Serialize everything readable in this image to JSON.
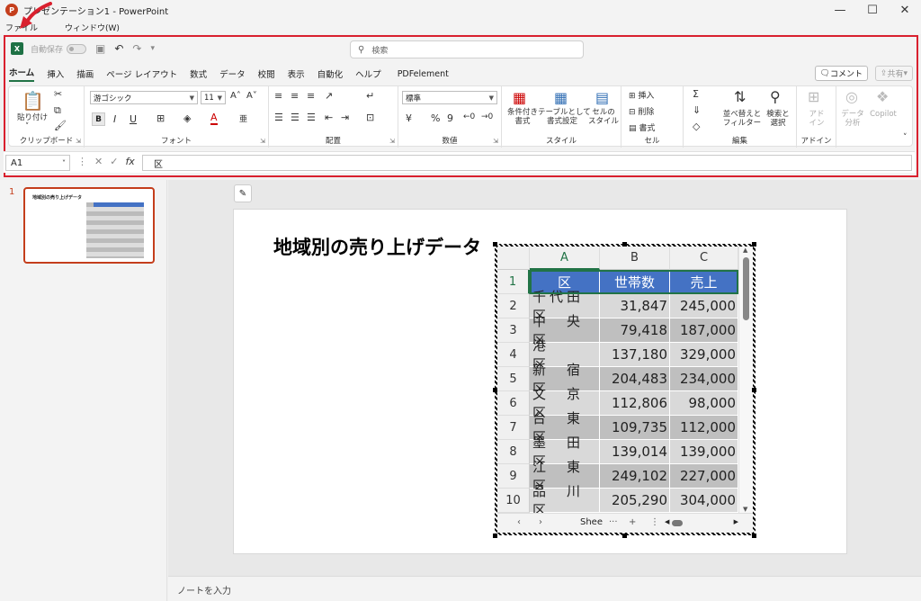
{
  "window": {
    "title": "プレゼンテーション1 - PowerPoint",
    "app_icon_letter": "P",
    "minimize": "—",
    "maximize": "☐",
    "close": "✕"
  },
  "menubar": {
    "file": "ファイル",
    "window": "ウィンドウ(W)"
  },
  "qat": {
    "excel_letter": "X",
    "autosave": "自動保存",
    "toggle_state": "オフ",
    "search_placeholder": "検索"
  },
  "tabs": [
    "ホーム",
    "挿入",
    "描画",
    "ページ レイアウト",
    "数式",
    "データ",
    "校閲",
    "表示",
    "自動化",
    "ヘルプ",
    "PDFelement"
  ],
  "comment_button": "コメント",
  "share_button": "共有",
  "ribbon": {
    "clipboard": {
      "paste": "貼り付け",
      "label": "クリップボード"
    },
    "font": {
      "font_name": "游ゴシック",
      "font_size": "11",
      "label": "フォント",
      "bold": "B",
      "italic": "I",
      "underline": "U",
      "grow": "A˄",
      "shrink": "A˅",
      "color_a": "A"
    },
    "alignment": {
      "label": "配置"
    },
    "number": {
      "format": "標準",
      "percent": "%",
      "comma": "9",
      "label": "数値"
    },
    "style": {
      "conditional": "条件付き\n書式",
      "as_table": "テーブルとして\n書式設定",
      "cell_style": "セルの\nスタイル",
      "label": "スタイル"
    },
    "cells": {
      "insert": "挿入",
      "delete": "削除",
      "format": "書式",
      "label": "セル"
    },
    "editing": {
      "sort_filter": "並べ替えと\nフィルター",
      "find_select": "検索と\n選択",
      "label": "編集"
    },
    "addins": {
      "addins": "アド\nイン",
      "label": "アドイン"
    },
    "data_analysis": "データ\n分析",
    "copilot": "Copilot"
  },
  "formula_bar": {
    "name_box": "A1",
    "fx": "fx",
    "content": "区"
  },
  "slide_pane": {
    "slide_number": "1",
    "thumb_title": "地域別の売り上げデータ"
  },
  "slide": {
    "title": "地域別の売り上げデータ"
  },
  "sheet": {
    "columns": [
      "A",
      "B",
      "C"
    ],
    "rows": [
      "1",
      "2",
      "3",
      "4",
      "5",
      "6",
      "7",
      "8",
      "9",
      "10"
    ],
    "header": [
      "区",
      "世帯数",
      "売上"
    ],
    "data": [
      [
        "千代田区",
        "31,847",
        "245,000"
      ],
      [
        "中　央　区",
        "79,418",
        "187,000"
      ],
      [
        "港　　　区",
        "137,180",
        "329,000"
      ],
      [
        "新　宿　区",
        "204,483",
        "234,000"
      ],
      [
        "文　京　区",
        "112,806",
        "98,000"
      ],
      [
        "台　東　区",
        "109,735",
        "112,000"
      ],
      [
        "墨　田　区",
        "139,014",
        "139,000"
      ],
      [
        "江　東　区",
        "249,102",
        "227,000"
      ],
      [
        "品　川　区",
        "205,290",
        "304,000"
      ]
    ],
    "sheet_tab": "Shee",
    "nav_prev": "‹",
    "nav_next": "›",
    "more": "···",
    "add": "+",
    "options": "⋮"
  },
  "notes": {
    "placeholder": "ノートを入力"
  },
  "colors": {
    "accent_red": "#d9202e",
    "powerpoint": "#c43e1c",
    "excel_green": "#217346",
    "table_header": "#4472c4"
  }
}
